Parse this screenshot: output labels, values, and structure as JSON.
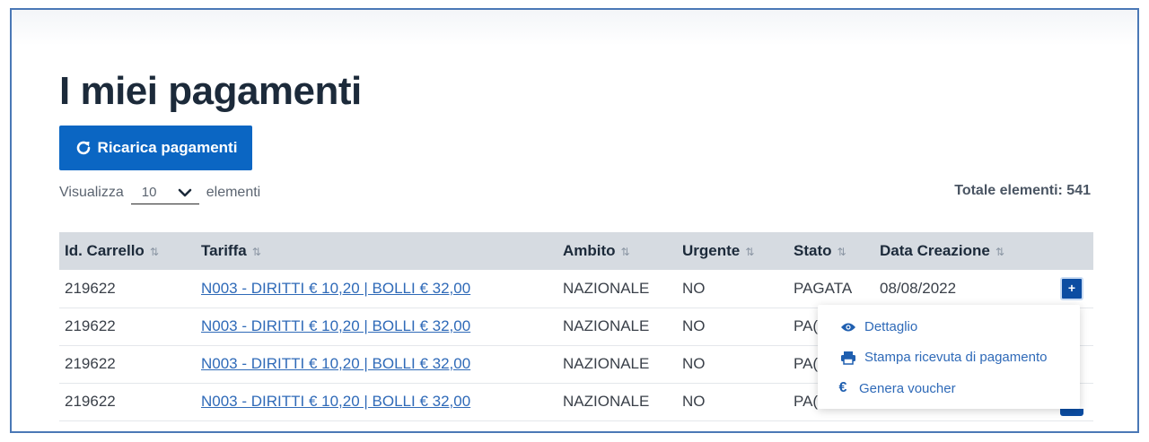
{
  "page": {
    "title": "I miei pagamenti"
  },
  "toolbar": {
    "reload_label": "Ricarica pagamenti"
  },
  "pagination": {
    "show_prefix": "Visualizza",
    "page_size": "10",
    "show_suffix": "elementi",
    "total_label": "Totale elementi: 541"
  },
  "table": {
    "headers": [
      "Id. Carrello",
      "Tariffa",
      "Ambito",
      "Urgente",
      "Stato",
      "Data Creazione"
    ],
    "rows": [
      {
        "id": "219622",
        "tariffa": "N003 - DIRITTI € 10,20 | BOLLI € 32,00",
        "ambito": "NAZIONALE",
        "urgente": "NO",
        "stato": "PAGATA",
        "data": "08/08/2022"
      },
      {
        "id": "219622",
        "tariffa": "N003 - DIRITTI € 10,20 | BOLLI € 32,00",
        "ambito": "NAZIONALE",
        "urgente": "NO",
        "stato": "PA(",
        "data": ""
      },
      {
        "id": "219622",
        "tariffa": "N003 - DIRITTI € 10,20 | BOLLI € 32,00",
        "ambito": "NAZIONALE",
        "urgente": "NO",
        "stato": "PA(",
        "data": ""
      },
      {
        "id": "219622",
        "tariffa": "N003 - DIRITTI € 10,20 | BOLLI € 32,00",
        "ambito": "NAZIONALE",
        "urgente": "NO",
        "stato": "PA(",
        "data": ""
      }
    ]
  },
  "row_actions": {
    "expand_label": "+",
    "menu": [
      {
        "icon": "eye-icon",
        "label": "Dettaglio"
      },
      {
        "icon": "printer-icon",
        "label": "Stampa ricevuta di pagamento"
      },
      {
        "icon": "euro-icon",
        "label": "Genera voucher"
      }
    ]
  },
  "colors": {
    "primary": "#0b66c3",
    "header_bg": "#d6dbe1",
    "link": "#2f6ab8",
    "frame_border": "#4a78b6"
  }
}
